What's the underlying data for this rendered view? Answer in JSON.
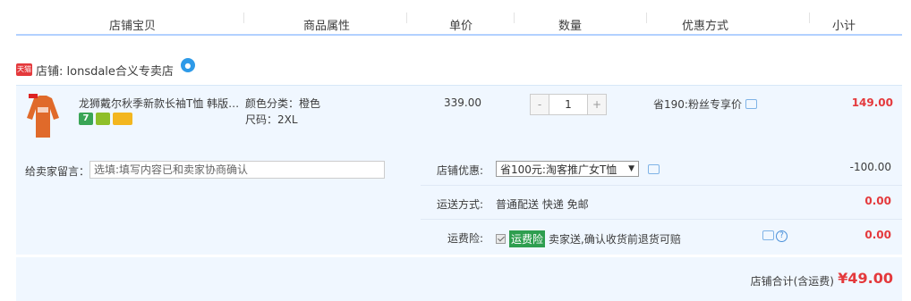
{
  "header": {
    "columns": [
      "店铺宝贝",
      "商品属性",
      "单价",
      "数量",
      "优惠方式",
      "小计"
    ]
  },
  "shop": {
    "badge": "天猫",
    "label": "店铺: lonsdale合义专卖店"
  },
  "item": {
    "title": "龙狮戴尔秋季新款长袖T恤 韩版修身",
    "attr_color": "颜色分类：橙色",
    "attr_size": "尺码：2XL",
    "price": "339.00",
    "qty_minus": "-",
    "qty_value": "1",
    "qty_plus": "+",
    "promo": "省190:粉丝专享价",
    "subtotal": "149.00",
    "svc_num": "7"
  },
  "message": {
    "label": "给卖家留言：",
    "placeholder": "选填:填写内容已和卖家协商确认"
  },
  "shop_discount": {
    "label": "店铺优惠:",
    "selected": "省100元:淘客推广女T恤",
    "amount": "-100.00"
  },
  "shipping": {
    "label": "运送方式:",
    "value": "普通配送 快递 免邮",
    "amount": "0.00"
  },
  "insurance": {
    "label": "运费险:",
    "tag": "运费险",
    "value": "卖家送,确认收货前退货可赔",
    "amount": "0.00"
  },
  "total": {
    "label": "店铺合计(含运费)",
    "amount": "¥49.00"
  },
  "colors": {
    "accent_red": "#e4393c",
    "row_bg": "#f0f7ff",
    "header_border": "#b2d1ff",
    "green_tag": "#2e9e4f"
  }
}
